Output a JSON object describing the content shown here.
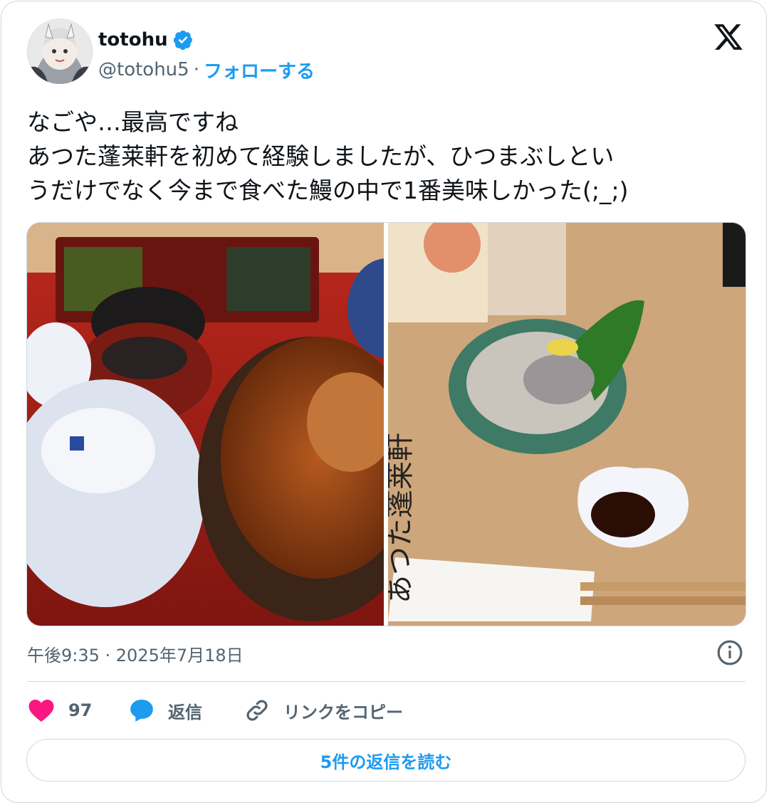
{
  "author": {
    "name": "totohu",
    "handle": "@totohu5",
    "separator": "·",
    "follow_label": "フォローする"
  },
  "tweet": {
    "text": "なごや…最高ですね\nあつた蓬莱軒を初めて経験しましたが、ひつまぶしとい\nうだけでなく今まで食べた鰻の中で1番美味しかった(;_;)",
    "timestamp": "午後9:35 · 2025年7月18日"
  },
  "media": {
    "photo1_icon": "hitsumabushi-photo",
    "photo2_icon": "eel-liver-sashimi-photo",
    "chopstick_wrapper_text": "あつた蓬莱軒"
  },
  "actions": {
    "like_count": "97",
    "reply_label": "返信",
    "copy_link_label": "リンクをコピー"
  },
  "read_replies_label": "5件の返信を読む",
  "colors": {
    "accent": "#1d9bf0",
    "like": "#f91880",
    "text": "#0f1419",
    "muted": "#536471",
    "border": "#cfd9de"
  }
}
